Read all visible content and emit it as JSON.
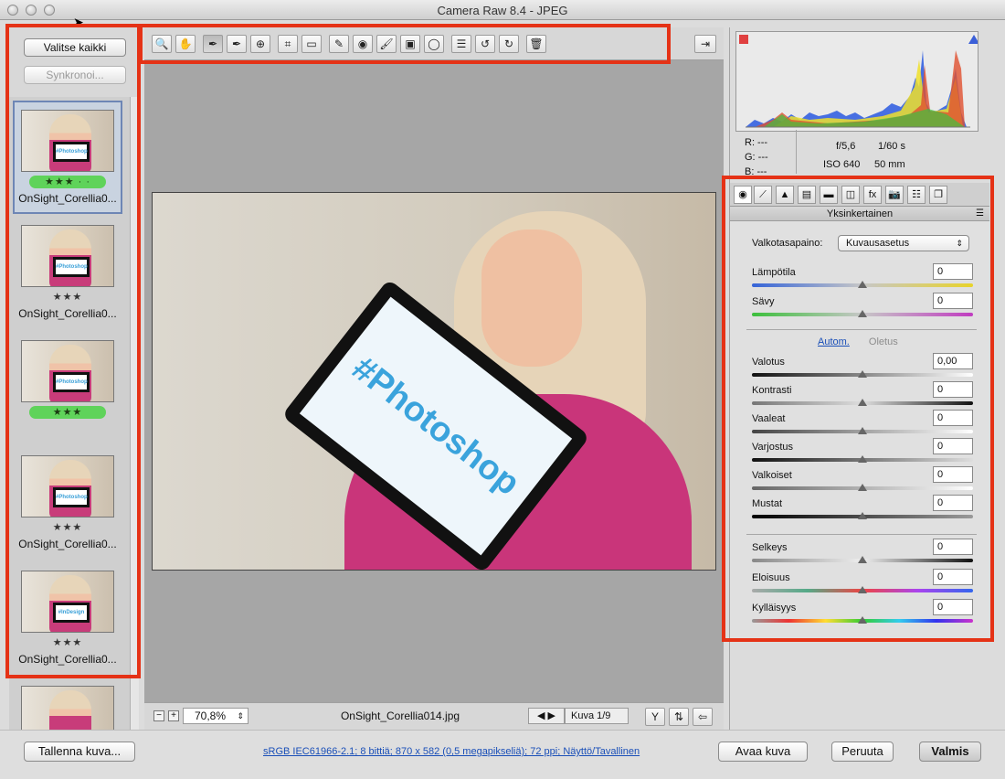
{
  "window": {
    "title": "Camera Raw 8.4  -  JPEG"
  },
  "filmstrip": {
    "select_all_label": "Valitse kaikki",
    "sync_label": "Synkronoi...",
    "items": [
      {
        "name": "OnSight_Corellia0...",
        "stars": "★★★ · ·",
        "green": true,
        "sign": "#Photoshop"
      },
      {
        "name": "OnSight_Corellia0...",
        "stars": "★★★",
        "green": false,
        "sign": "#Photoshop"
      },
      {
        "name": "",
        "stars": "★★★",
        "green": true,
        "sign": "#Photoshop"
      },
      {
        "name": "OnSight_Corellia0...",
        "stars": "★★★",
        "green": false,
        "sign": "#Photoshop"
      },
      {
        "name": "OnSight_Corellia0...",
        "stars": "★★★",
        "green": false,
        "sign": "#InDesign"
      }
    ]
  },
  "toolbar": {
    "tools": [
      {
        "icon": "zoom-icon",
        "glyph": "🔍"
      },
      {
        "icon": "hand-icon",
        "glyph": "✋"
      },
      {
        "icon": "white-balance-icon",
        "glyph": "✒"
      },
      {
        "icon": "color-sampler-icon",
        "glyph": "✒"
      },
      {
        "icon": "targeted-adjust-icon",
        "glyph": "⊕"
      },
      {
        "icon": "crop-icon",
        "glyph": "⌗"
      },
      {
        "icon": "straighten-icon",
        "glyph": "▭"
      },
      {
        "icon": "spot-removal-icon",
        "glyph": "✎"
      },
      {
        "icon": "red-eye-icon",
        "glyph": "◉"
      },
      {
        "icon": "adjustment-brush-icon",
        "glyph": "🖌"
      },
      {
        "icon": "graduated-filter-icon",
        "glyph": "▣"
      },
      {
        "icon": "radial-filter-icon",
        "glyph": "◯"
      },
      {
        "icon": "preferences-icon",
        "glyph": "☰"
      },
      {
        "icon": "rotate-left-icon",
        "glyph": "↺"
      },
      {
        "icon": "rotate-right-icon",
        "glyph": "↻"
      },
      {
        "icon": "trash-icon",
        "glyph": "🗑"
      }
    ]
  },
  "preview": {
    "sign_text": "#Photoshop",
    "zoom": "70,8%",
    "filename": "OnSight_Corellia014.jpg",
    "counter": "Kuva 1/9"
  },
  "info": {
    "r": "R:  ---",
    "g": "G:  ---",
    "b": "B:  ---",
    "aperture": "f/5,6",
    "shutter": "1/60 s",
    "iso": "ISO 640",
    "focal": "50 mm"
  },
  "panel": {
    "title": "Yksinkertainen",
    "wb_label": "Valkotasapaino:",
    "wb_value": "Kuvausasetus",
    "auto_label": "Autom.",
    "default_label": "Oletus",
    "sliders": [
      {
        "label": "Lämpötila",
        "value": "0",
        "pos": 0.5
      },
      {
        "label": "Sävy",
        "value": "0",
        "pos": 0.5
      },
      {
        "label": "Valotus",
        "value": "0,00",
        "pos": 0.5
      },
      {
        "label": "Kontrasti",
        "value": "0",
        "pos": 0.5
      },
      {
        "label": "Vaaleat",
        "value": "0",
        "pos": 0.5
      },
      {
        "label": "Varjostus",
        "value": "0",
        "pos": 0.5
      },
      {
        "label": "Valkoiset",
        "value": "0",
        "pos": 0.5
      },
      {
        "label": "Mustat",
        "value": "0",
        "pos": 0.5
      },
      {
        "label": "Selkeys",
        "value": "0",
        "pos": 0.5
      },
      {
        "label": "Eloisuus",
        "value": "0",
        "pos": 0.5
      },
      {
        "label": "Kylläisyys",
        "value": "0",
        "pos": 0.5
      }
    ]
  },
  "bottom": {
    "save_label": "Tallenna kuva...",
    "workflow": "sRGB IEC61966-2.1; 8 bittiä; 870 x 582 (0,5 megapikseliä); 72 ppi; Näyttö/Tavallinen",
    "open_label": "Avaa kuva",
    "cancel_label": "Peruuta",
    "done_label": "Valmis"
  },
  "colors": {
    "highlight": "#e53216",
    "link": "#1a4fb8",
    "green_rating": "#5fd35a"
  }
}
